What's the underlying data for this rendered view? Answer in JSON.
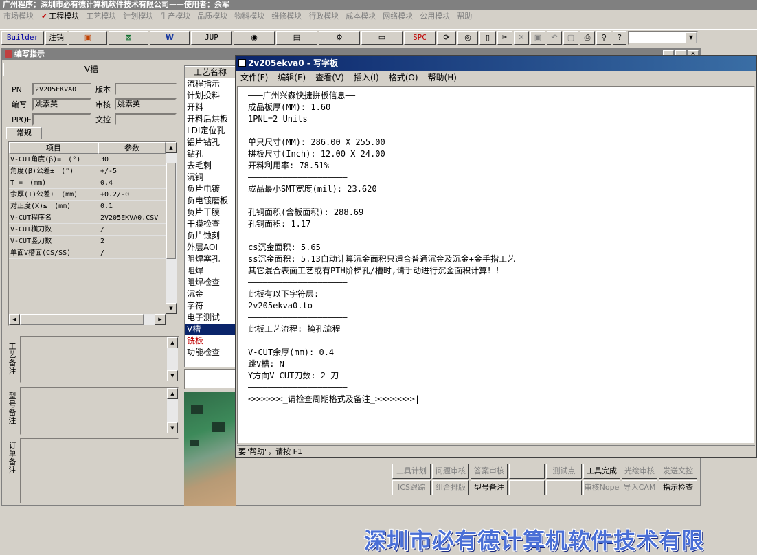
{
  "app": {
    "title": "广州程序：深圳市必有德计算机软件技术有限公司——使用者：余军"
  },
  "menubar": [
    "市场模块",
    "工程模块",
    "工艺模块",
    "计划模块",
    "生产模块",
    "品质模块",
    "物料模块",
    "维修模块",
    "行政模块",
    "成本模块",
    "网络模块",
    "公用模块",
    "帮助"
  ],
  "toolbar": {
    "builder": "Builder",
    "logout": "注销",
    "jup": "JUP",
    "spc": "SPC"
  },
  "subwindow": {
    "title": "编写指示",
    "section": "V槽",
    "pn_label": "PN",
    "pn_value": "2V205EKVA0",
    "version_label": "版本",
    "version_value": "",
    "writer_label": "编写",
    "writer_value": "姚素英",
    "review_label": "审核",
    "review_value": "姚素英",
    "ppqe_label": "PPQE",
    "ppqe_value": "",
    "doc_control_label": "文控",
    "doc_control_value": "",
    "tab": "常规",
    "grid_headers": [
      "项目",
      "参数"
    ],
    "grid_rows": [
      [
        "V-CUT角度(β)=　(°)",
        "30"
      ],
      [
        "角度(β)公差±　(°)",
        "+/-5"
      ],
      [
        "T =　(mm)",
        "0.4"
      ],
      [
        "余厚(T)公差±　(mm)",
        "+0.2/-0"
      ],
      [
        "对正度(X)≤　(mm)",
        "0.1"
      ],
      [
        "V-CUT程序名",
        "2V205EKVA0.CSV"
      ],
      [
        "V-CUT横刀数",
        "/"
      ],
      [
        "V-CUT竖刀数",
        "2"
      ],
      [
        "单面V槽面(CS/SS)",
        "/"
      ]
    ],
    "remark_labels": [
      "工艺备注",
      "型号备注",
      "订单备注"
    ]
  },
  "process": {
    "header": "工艺名称",
    "items": [
      "流程指示",
      "计划投料",
      "开料",
      "开料后烘板",
      "LDI定位孔",
      "铝片钻孔",
      "钻孔",
      "去毛刺",
      "沉铜",
      "负片电镀",
      "负电镀磨板",
      "负片干膜",
      "干膜检查",
      "负片蚀刻",
      "外层AOI",
      "阻焊塞孔",
      "阻焊",
      "阻焊检查",
      "沉金",
      "字符",
      "电子测试",
      "V槽",
      "铣板",
      "功能检查"
    ],
    "selected": "V槽",
    "red": "铣板"
  },
  "wordpad": {
    "title": "2v205ekva0 - 写字板",
    "menu": [
      "文件(F)",
      "编辑(E)",
      "查看(V)",
      "插入(I)",
      "格式(O)",
      "帮助(H)"
    ],
    "lines": [
      "———广州兴森快捷拼板信息——",
      "成品板厚(MM): 1.60",
      "1PNL=2 Units",
      "————————————————————",
      "单只尺寸(MM): 286.00 X 255.00",
      "拼板尺寸(Inch): 12.00 X 24.00",
      "开料利用率: 78.51%",
      "————————————————————",
      "成品最小SMT宽度(mil): 23.620",
      "————————————————————",
      "孔铜面积(含板面积): 288.69",
      "孔铜面积: 1.17",
      "————————————————————",
      "cs沉金面积: 5.65",
      "ss沉金面积: 5.13自动计算沉金面积只适合普通沉金及沉金+金手指工艺",
      "其它混合表面工艺或有PTH阶梯孔/槽时,请手动进行沉金面积计算！！",
      "————————————————————",
      "此板有以下字符层:",
      "2v205ekva0.to",
      "————————————————————",
      "此板工艺流程: 掩孔流程",
      "————————————————————",
      "V-CUT余厚(mm): 0.4",
      "跳V槽: N",
      "Y方向V-CUT刀数: 2 刀",
      "————————————————————",
      "<<<<<<<_请检查周期格式及备注_>>>>>>>>|"
    ],
    "status": "要\"帮助\"，请按 F1"
  },
  "bottom_buttons": {
    "row1": [
      "工具计划",
      "问题审核",
      "答案审核",
      "",
      "测试点",
      "工具完成",
      "光绘审核",
      "发送文控"
    ],
    "row2": [
      "ICS跟踪",
      "组合排版",
      "型号备注",
      "",
      "",
      "审核Nope",
      "导入CAM",
      "指示检查"
    ]
  },
  "banner": "深圳市必有德计算机软件技术有限"
}
